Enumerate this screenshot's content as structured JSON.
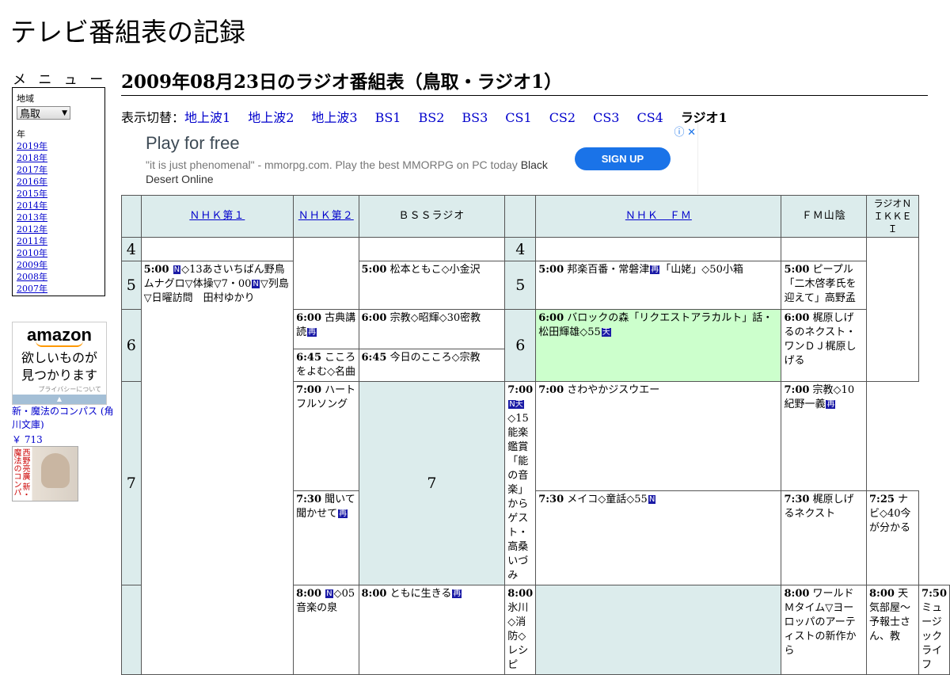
{
  "site": {
    "title": "テレビ番組表の記録"
  },
  "menu": {
    "label": "メ ニ ュ ー",
    "region_label": "地域",
    "region_value": "鳥取",
    "year_label": "年",
    "years": [
      "2019年",
      "2018年",
      "2017年",
      "2016年",
      "2015年",
      "2014年",
      "2013年",
      "2012年",
      "2011年",
      "2010年",
      "2009年",
      "2008年",
      "2007年"
    ]
  },
  "amazon": {
    "logo": "amazon",
    "tagline_1": "欲しいものが",
    "tagline_2": "見つかります",
    "privacy": "プライバシーについて",
    "book_title": "新・魔法のコンパス (角川文庫)",
    "book_price": "￥ 713",
    "cover_text": "西野亮廣 新・魔法のコンパス"
  },
  "page": {
    "heading": "2009年08月23日のラジオ番組表（鳥取・ラジオ1）"
  },
  "switcher": {
    "label": "表示切替：",
    "links": [
      "地上波1",
      "地上波2",
      "地上波3",
      "BS1",
      "BS2",
      "BS3",
      "CS1",
      "CS2",
      "CS3",
      "CS4"
    ],
    "current": "ラジオ1"
  },
  "ad": {
    "title": "Play for free",
    "desc_quote": "\"it is just phenomenal\" - mmorpg.com. Play the best MMORPG on PC today",
    "desc_brand": "Black Desert Online",
    "button": "SIGN UP",
    "icons": "ⓘ ✕"
  },
  "channels": [
    {
      "name": "ＮＨＫ第１",
      "link": true
    },
    {
      "name": "ＮＨＫ第２",
      "link": true
    },
    {
      "name": "ＢＳＳラジオ",
      "link": false
    },
    {
      "name": "ＮＨＫ　ＦＭ",
      "link": true
    },
    {
      "name": "ＦＭ山陰",
      "link": false
    },
    {
      "name": "ラジオＮＩＫＫＥＩ",
      "link": false
    }
  ],
  "hours": [
    "4",
    "5",
    "6",
    "7"
  ],
  "programs": {
    "nhk1_500_time": "5:00",
    "nhk1_500_text": "◇13あさいちばん野鳥ムナグロ▽体操▽7・00",
    "nhk1_500_text2": "▽列島▽日曜訪問　田村ゆかり",
    "nhk1_800_time": "8:00",
    "nhk1_800_text": "◇05音楽の泉",
    "nhk2_600_time": "6:00",
    "nhk2_600_text": "古典講読",
    "nhk2_645_time": "6:45",
    "nhk2_645_text": "こころをよむ◇名曲",
    "nhk2_730_time": "7:30",
    "nhk2_730_text": "聞いて聞かせて",
    "nhk2_800_time": "8:00",
    "nhk2_800_text": "ともに生きる",
    "bss_500_time": "5:00",
    "bss_500_text": "松本ともこ◇小金沢",
    "bss_600_time": "6:00",
    "bss_600_text": "宗教◇昭輝◇30密教",
    "bss_645_time": "6:45",
    "bss_645_text": "今日のこころ◇宗教",
    "bss_700_time": "7:00",
    "bss_700_text": "ハートフルソング",
    "bss_730_time": "7:30",
    "bss_730_text": "メイコ◇童話◇55",
    "bss_800_time": "8:00",
    "bss_800_text": "氷川◇消防◇レシピ",
    "fm_500_time": "5:00",
    "fm_500_text": "邦楽百番・常磐津",
    "fm_500_text2": "「山姥」◇50小箱",
    "fm_600_time": "6:00",
    "fm_600_text": "バロックの森「リクエストアラカルト」話・松田輝雄◇55",
    "fm_700_time": "7:00",
    "fm_700_text": "◇15能楽鑑賞「能の音楽」からゲスト・高桑いづみ",
    "fm_800_time": "8:00",
    "fm_800_text": "ワールドＭタイム▽ヨーロッパのアーティストの新作から",
    "san_500_time": "5:00",
    "san_500_text": "ピープル「二木啓孝氏を迎えて」高野孟",
    "san_600_time": "6:00",
    "san_600_text": "梶原しげるのネクスト・ワンＤＪ梶原しげる",
    "san_700_time": "7:00",
    "san_700_text": "さわやかジスウエー",
    "san_730_time": "7:30",
    "san_730_text": "梶原しげるネクスト",
    "san_800_time": "8:00",
    "san_800_text": "天気部屋～予報士さん、教",
    "nikkei_700_time": "7:00",
    "nikkei_700_text": "宗教◇10紀野一義",
    "nikkei_725_time": "7:25",
    "nikkei_725_text": "ナビ◇40今が分かる",
    "nikkei_750_time": "7:50",
    "nikkei_750_text": "ミュージックライフ"
  },
  "icons": {
    "n": "N",
    "re": "再",
    "ten": "天",
    "nten": "N天"
  },
  "colors": {
    "header_bg": "#dcecec",
    "highlight_bg": "#ccffcc",
    "link": "#0000cc",
    "icon_bg": "#1a1aa6",
    "ad_button": "#1a73e8"
  }
}
